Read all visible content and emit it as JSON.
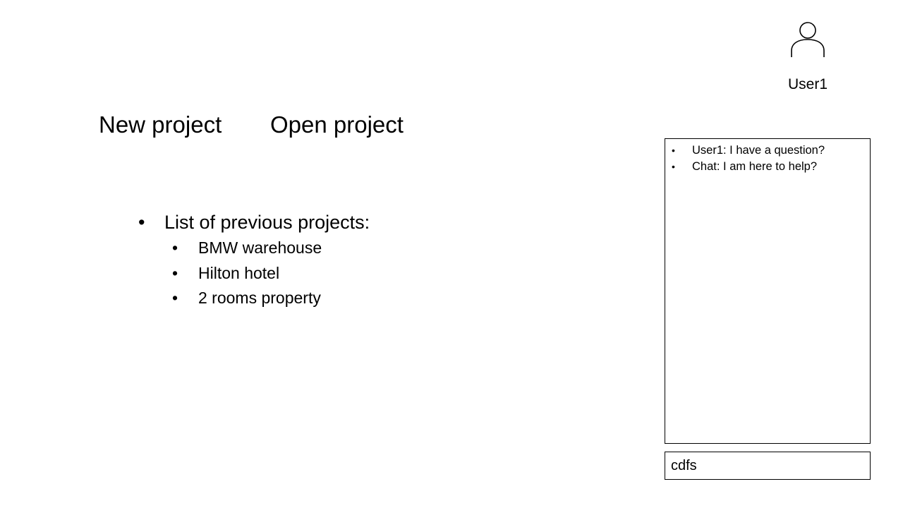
{
  "user": {
    "name": "User1",
    "icon": "user-icon"
  },
  "actions": {
    "new_project": "New project",
    "open_project": "Open project"
  },
  "projects": {
    "heading": "List of previous projects:",
    "items": [
      {
        "label": "BMW warehouse"
      },
      {
        "label": "Hilton hotel"
      },
      {
        "label": "2 rooms property"
      }
    ]
  },
  "chat": {
    "messages": [
      {
        "text": "User1: I have a question?"
      },
      {
        "text": "Chat: I am here to help?"
      }
    ],
    "input_value": "cdfs"
  },
  "bullet_glyph": "•"
}
